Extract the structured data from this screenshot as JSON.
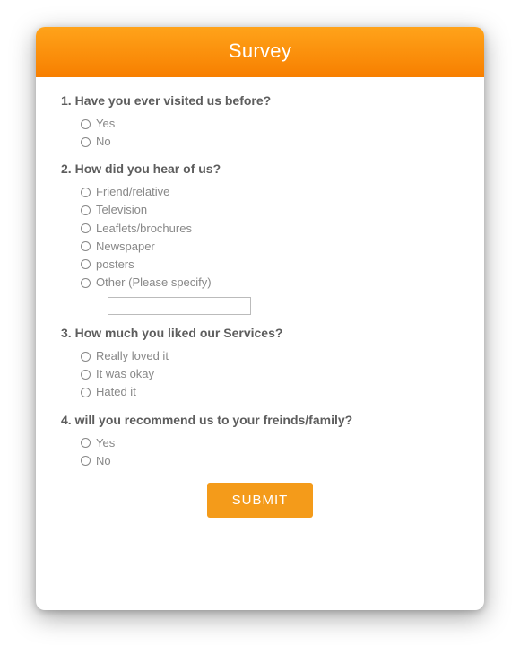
{
  "header": {
    "title": "Survey"
  },
  "questions": [
    {
      "number": "1.",
      "text": "Have you ever visited us before?",
      "options": [
        "Yes",
        "No"
      ]
    },
    {
      "number": "2.",
      "text": "How did you hear of us?",
      "options": [
        "Friend/relative",
        "Television",
        "Leaflets/brochures",
        "Newspaper",
        "posters",
        "Other (Please specify)"
      ],
      "has_other_input": true
    },
    {
      "number": "3.",
      "text": "How much you liked our Services?",
      "options": [
        "Really loved it",
        "It was okay",
        "Hated it"
      ]
    },
    {
      "number": "4.",
      "text": "will you recommend us to your freinds/family?",
      "options": [
        "Yes",
        "No"
      ]
    }
  ],
  "submit": {
    "label": "SUBMIT"
  },
  "other_input": {
    "value": ""
  }
}
